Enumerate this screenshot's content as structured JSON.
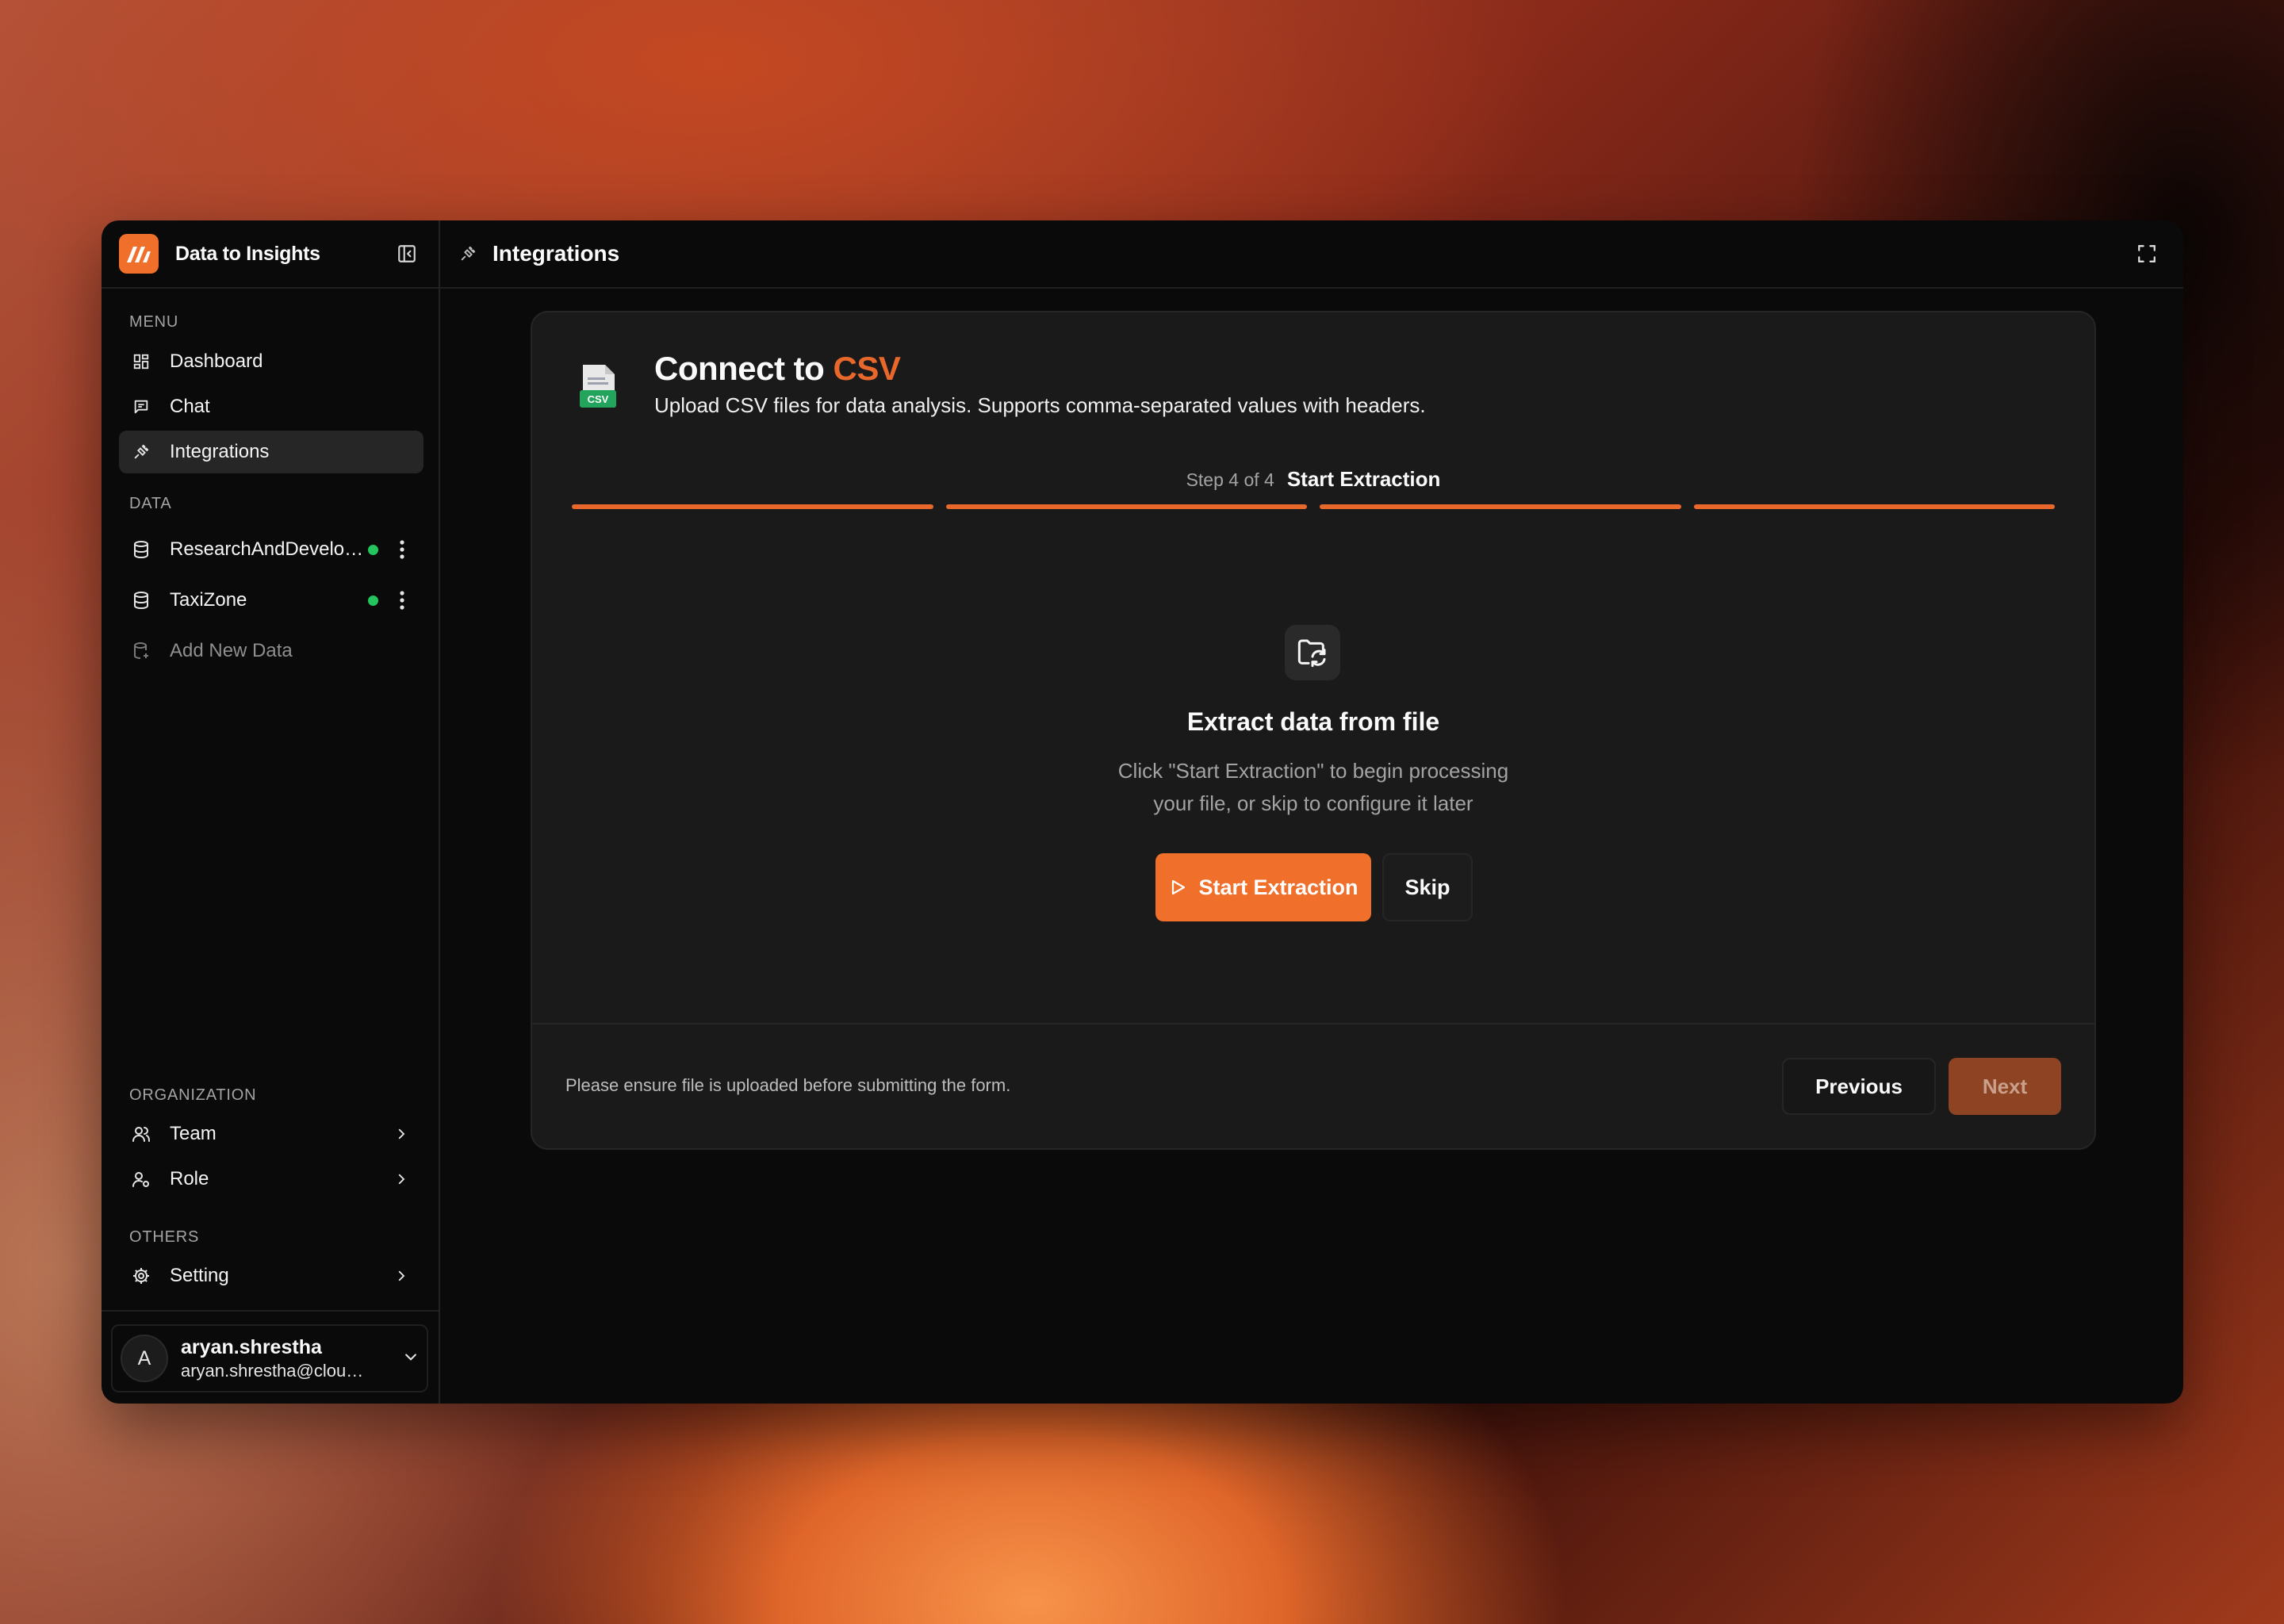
{
  "app": {
    "name": "Data to Insights"
  },
  "sidebar": {
    "menu_label": "MENU",
    "menu": [
      {
        "label": "Dashboard",
        "icon": "dashboard-icon"
      },
      {
        "label": "Chat",
        "icon": "chat-icon"
      },
      {
        "label": "Integrations",
        "icon": "integrations-plug-icon",
        "active": true
      }
    ],
    "data_label": "DATA",
    "data": [
      {
        "label": "ResearchAndDevelop...",
        "status": "connected"
      },
      {
        "label": "TaxiZone",
        "status": "connected"
      }
    ],
    "add_data_label": "Add New Data",
    "org_label": "ORGANIZATION",
    "org": [
      {
        "label": "Team"
      },
      {
        "label": "Role"
      }
    ],
    "others_label": "OTHERS",
    "others": [
      {
        "label": "Setting"
      }
    ],
    "user": {
      "initial": "A",
      "name": "aryan.shrestha",
      "email": "aryan.shrestha@cloudp..."
    }
  },
  "header": {
    "title": "Integrations"
  },
  "card": {
    "title_prefix": "Connect to ",
    "title_accent": "CSV",
    "csv_icon_text": "CSV",
    "subtitle": "Upload CSV files for data analysis. Supports comma-separated values with headers.",
    "step_count": "Step 4 of 4",
    "step_name": "Start Extraction",
    "steps_total": 4,
    "steps_complete": 4,
    "extract_title": "Extract data from file",
    "extract_desc_1": "Click \"Start Extraction\" to begin processing",
    "extract_desc_2": "your file, or skip to configure it later",
    "start_label": "Start Extraction",
    "skip_label": "Skip",
    "footer_note": "Please ensure file is uploaded before submitting the form.",
    "prev_label": "Previous",
    "next_label": "Next"
  },
  "colors": {
    "accent": "#f06f2a",
    "accent_text": "#e8682c",
    "status_ok": "#22c55e",
    "next_disabled": "#8e4423"
  }
}
